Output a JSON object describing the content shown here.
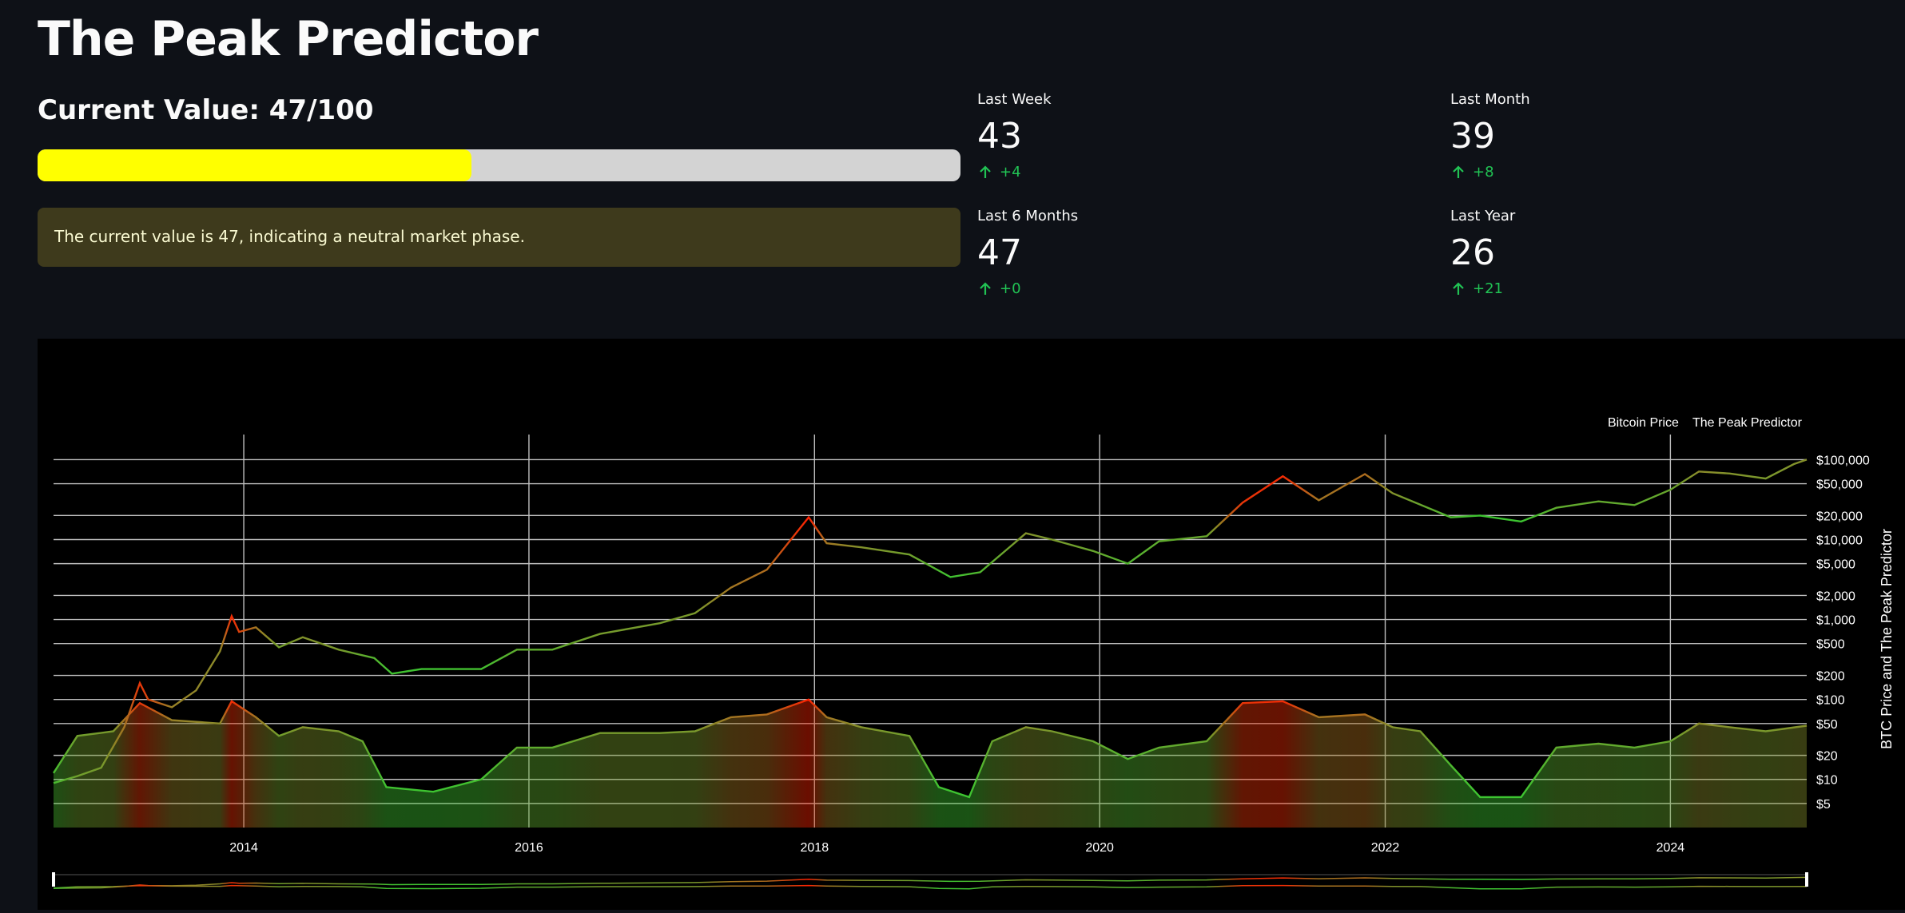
{
  "page": {
    "title": "The Peak Predictor"
  },
  "current": {
    "label": "Current Value: 47/100",
    "progress": 0.47,
    "message": "The current value is 47, indicating a neutral market phase."
  },
  "metrics": [
    {
      "label": "Last Week",
      "value": "43",
      "delta": "+4"
    },
    {
      "label": "Last Month",
      "value": "39",
      "delta": "+8"
    },
    {
      "label": "Last 6 Months",
      "value": "47",
      "delta": "+0"
    },
    {
      "label": "Last Year",
      "value": "26",
      "delta": "+21"
    }
  ],
  "colors": {
    "bar_fill": "#ffff00",
    "delta_up": "#21c354",
    "low": "#32cd32",
    "mid": "#8b8b2a",
    "high": "#ff2000"
  },
  "chart_data": {
    "type": "line",
    "title": "",
    "ylabel": "BTC Price and The Peak Predictor",
    "y_scale": "log",
    "ylim": [
      2.5,
      130000
    ],
    "xlim": [
      "2012-09-01",
      "2024-12-15"
    ],
    "legend": {
      "placement": "top-right",
      "entries": [
        "Bitcoin Price",
        "The Peak Predictor"
      ]
    },
    "x_ticks": [
      {
        "date": "2014-01-01",
        "label": "2014"
      },
      {
        "date": "2016-01-01",
        "label": "2016"
      },
      {
        "date": "2018-01-01",
        "label": "2018"
      },
      {
        "date": "2020-01-01",
        "label": "2020"
      },
      {
        "date": "2022-01-01",
        "label": "2022"
      },
      {
        "date": "2024-01-01",
        "label": "2024"
      }
    ],
    "y_ticks": [
      {
        "value": 100000,
        "label": "$100,000"
      },
      {
        "value": 50000,
        "label": "$50,000"
      },
      {
        "value": 20000,
        "label": "$20,000"
      },
      {
        "value": 10000,
        "label": "$10,000"
      },
      {
        "value": 5000,
        "label": "$5,000"
      },
      {
        "value": 2000,
        "label": "$2,000"
      },
      {
        "value": 1000,
        "label": "$1,000"
      },
      {
        "value": 500,
        "label": "$500"
      },
      {
        "value": 200,
        "label": "$200"
      },
      {
        "value": 100,
        "label": "$100"
      },
      {
        "value": 50,
        "label": "$50"
      },
      {
        "value": 20,
        "label": "$20"
      },
      {
        "value": 10,
        "label": "$10"
      },
      {
        "value": 5,
        "label": "$5"
      }
    ],
    "series": [
      {
        "name": "Bitcoin Price",
        "points": [
          [
            "2012-09-01",
            9
          ],
          [
            "2012-11-01",
            11
          ],
          [
            "2013-01-01",
            14
          ],
          [
            "2013-03-01",
            45
          ],
          [
            "2013-04-10",
            160
          ],
          [
            "2013-05-01",
            100
          ],
          [
            "2013-07-01",
            80
          ],
          [
            "2013-09-01",
            130
          ],
          [
            "2013-11-01",
            400
          ],
          [
            "2013-12-01",
            1100
          ],
          [
            "2013-12-20",
            700
          ],
          [
            "2014-02-01",
            800
          ],
          [
            "2014-04-01",
            450
          ],
          [
            "2014-06-01",
            600
          ],
          [
            "2014-09-01",
            420
          ],
          [
            "2014-12-01",
            330
          ],
          [
            "2015-01-15",
            210
          ],
          [
            "2015-04-01",
            240
          ],
          [
            "2015-09-01",
            240
          ],
          [
            "2015-12-01",
            420
          ],
          [
            "2016-03-01",
            420
          ],
          [
            "2016-07-01",
            660
          ],
          [
            "2016-12-01",
            900
          ],
          [
            "2017-03-01",
            1200
          ],
          [
            "2017-06-01",
            2500
          ],
          [
            "2017-09-01",
            4200
          ],
          [
            "2017-12-17",
            19000
          ],
          [
            "2018-02-01",
            9000
          ],
          [
            "2018-05-01",
            8000
          ],
          [
            "2018-09-01",
            6500
          ],
          [
            "2018-12-15",
            3400
          ],
          [
            "2019-03-01",
            3900
          ],
          [
            "2019-06-26",
            12000
          ],
          [
            "2019-09-01",
            10000
          ],
          [
            "2019-12-15",
            7200
          ],
          [
            "2020-03-13",
            5000
          ],
          [
            "2020-06-01",
            9500
          ],
          [
            "2020-10-01",
            11000
          ],
          [
            "2021-01-01",
            29000
          ],
          [
            "2021-04-14",
            62000
          ],
          [
            "2021-07-15",
            31000
          ],
          [
            "2021-11-10",
            66000
          ],
          [
            "2022-01-20",
            38000
          ],
          [
            "2022-06-18",
            19000
          ],
          [
            "2022-09-01",
            20000
          ],
          [
            "2022-12-15",
            16800
          ],
          [
            "2023-03-15",
            25000
          ],
          [
            "2023-07-01",
            30000
          ],
          [
            "2023-10-01",
            27000
          ],
          [
            "2024-01-01",
            42000
          ],
          [
            "2024-03-14",
            71000
          ],
          [
            "2024-06-01",
            67000
          ],
          [
            "2024-09-01",
            58000
          ],
          [
            "2024-11-12",
            88000
          ],
          [
            "2024-12-15",
            100000
          ]
        ]
      },
      {
        "name": "The Peak Predictor",
        "points": [
          [
            "2012-09-01",
            12
          ],
          [
            "2012-11-01",
            35
          ],
          [
            "2013-02-01",
            40
          ],
          [
            "2013-04-10",
            90
          ],
          [
            "2013-07-01",
            55
          ],
          [
            "2013-11-01",
            50
          ],
          [
            "2013-12-01",
            95
          ],
          [
            "2014-02-01",
            60
          ],
          [
            "2014-04-01",
            35
          ],
          [
            "2014-06-01",
            45
          ],
          [
            "2014-09-01",
            40
          ],
          [
            "2014-11-01",
            30
          ],
          [
            "2015-01-01",
            8
          ],
          [
            "2015-05-01",
            7
          ],
          [
            "2015-09-01",
            10
          ],
          [
            "2015-12-01",
            25
          ],
          [
            "2016-03-01",
            25
          ],
          [
            "2016-07-01",
            38
          ],
          [
            "2016-12-01",
            38
          ],
          [
            "2017-03-01",
            40
          ],
          [
            "2017-06-01",
            60
          ],
          [
            "2017-09-01",
            65
          ],
          [
            "2017-12-17",
            100
          ],
          [
            "2018-02-01",
            60
          ],
          [
            "2018-05-01",
            45
          ],
          [
            "2018-09-01",
            35
          ],
          [
            "2018-11-15",
            8
          ],
          [
            "2019-02-01",
            6
          ],
          [
            "2019-04-01",
            30
          ],
          [
            "2019-06-26",
            45
          ],
          [
            "2019-09-01",
            40
          ],
          [
            "2019-12-15",
            30
          ],
          [
            "2020-03-13",
            18
          ],
          [
            "2020-06-01",
            25
          ],
          [
            "2020-10-01",
            30
          ],
          [
            "2021-01-01",
            90
          ],
          [
            "2021-04-14",
            95
          ],
          [
            "2021-07-15",
            60
          ],
          [
            "2021-11-10",
            65
          ],
          [
            "2022-01-20",
            45
          ],
          [
            "2022-04-01",
            40
          ],
          [
            "2022-06-18",
            15
          ],
          [
            "2022-09-01",
            6
          ],
          [
            "2022-12-15",
            6
          ],
          [
            "2023-03-15",
            25
          ],
          [
            "2023-07-01",
            28
          ],
          [
            "2023-10-01",
            25
          ],
          [
            "2024-01-01",
            30
          ],
          [
            "2024-03-14",
            50
          ],
          [
            "2024-06-01",
            45
          ],
          [
            "2024-09-01",
            40
          ],
          [
            "2024-12-15",
            47
          ]
        ]
      }
    ]
  }
}
